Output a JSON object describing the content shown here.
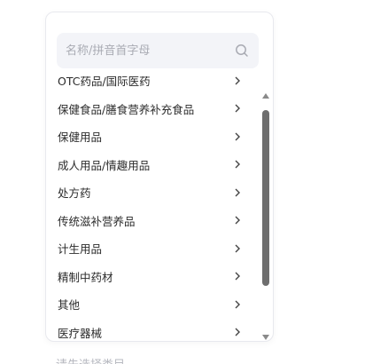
{
  "search": {
    "placeholder": "名称/拼音首字母"
  },
  "categories": [
    "OTC药品/国际医药",
    "保健食品/膳食营养补充食品",
    "保健用品",
    "成人用品/情趣用品",
    "处方药",
    "传统滋补营养品",
    "计生用品",
    "精制中药材",
    "其他",
    "医疗器械"
  ],
  "hint_text": "请先选择类目",
  "colors": {
    "search_bg": "#f3f4f8",
    "border": "#e8e9ee",
    "scroll_thumb": "#6e6e6e",
    "text": "#2b2b2b",
    "placeholder": "#a9abb3"
  },
  "icons": {
    "search": "search-icon",
    "chevron": "chevron-right-icon"
  }
}
